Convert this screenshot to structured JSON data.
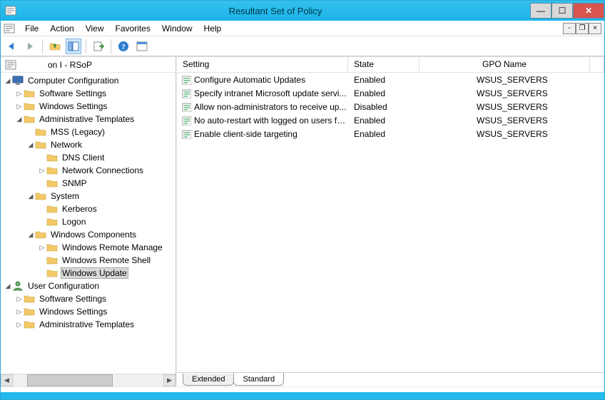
{
  "window": {
    "title": "Resultant Set of Policy"
  },
  "menubar": {
    "file": "File",
    "action": "Action",
    "view": "View",
    "favorites": "Favorites",
    "window": "Window",
    "help": "Help"
  },
  "tree": {
    "root_label": "on I              - RSoP",
    "computer_config": "Computer Configuration",
    "software_settings": "Software Settings",
    "windows_settings": "Windows Settings",
    "admin_templates": "Administrative Templates",
    "mss": "MSS (Legacy)",
    "network": "Network",
    "dns_client": "DNS Client",
    "network_connections": "Network Connections",
    "snmp": "SNMP",
    "system": "System",
    "kerberos": "Kerberos",
    "logon": "Logon",
    "windows_components": "Windows Components",
    "wrm": "Windows Remote Manage",
    "wrs": "Windows Remote Shell",
    "windows_update": "Windows Update",
    "user_config": "User Configuration",
    "u_software_settings": "Software Settings",
    "u_windows_settings": "Windows Settings",
    "u_admin_templates": "Administrative Templates"
  },
  "columns": {
    "setting": "Setting",
    "state": "State",
    "gpo": "GPO Name"
  },
  "rows": [
    {
      "setting": "Configure Automatic Updates",
      "state": "Enabled",
      "gpo": "WSUS_SERVERS"
    },
    {
      "setting": "Specify intranet Microsoft update servi...",
      "state": "Enabled",
      "gpo": "WSUS_SERVERS"
    },
    {
      "setting": "Allow non-administrators to receive up...",
      "state": "Disabled",
      "gpo": "WSUS_SERVERS"
    },
    {
      "setting": "No auto-restart with logged on users fo...",
      "state": "Enabled",
      "gpo": "WSUS_SERVERS"
    },
    {
      "setting": "Enable client-side targeting",
      "state": "Enabled",
      "gpo": "WSUS_SERVERS"
    }
  ],
  "tabs": {
    "extended": "Extended",
    "standard": "Standard"
  }
}
